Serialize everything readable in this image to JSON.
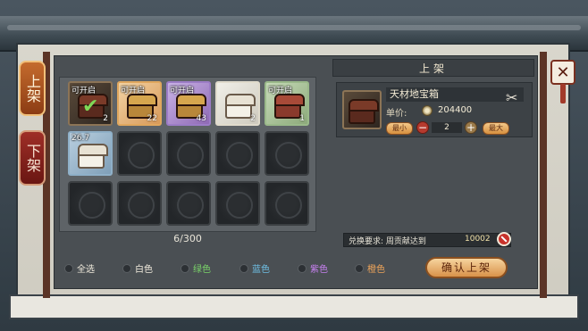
{
  "side_tabs": [
    {
      "label": "上架",
      "active": true
    },
    {
      "label": "下架",
      "active": false
    }
  ],
  "close_icon": "close-x-icon",
  "inventory": {
    "count": "6/300",
    "slots": [
      {
        "state": "item",
        "quality": "dark",
        "tag": "可开启",
        "count": "2",
        "selected": true,
        "icon": "chest-icon"
      },
      {
        "state": "item",
        "quality": "orange",
        "tag": "可开启",
        "count": "22",
        "selected": false,
        "icon": "chest-icon"
      },
      {
        "state": "item",
        "quality": "purple",
        "tag": "可开启",
        "count": "43",
        "selected": false,
        "icon": "chest-icon"
      },
      {
        "state": "item",
        "quality": "white",
        "tag": "",
        "count": "2",
        "selected": false,
        "icon": "chest-icon"
      },
      {
        "state": "item",
        "quality": "green",
        "tag": "可开启",
        "count": "1",
        "selected": false,
        "icon": "chest-icon"
      },
      {
        "state": "item",
        "quality": "blue",
        "tag": "26.7",
        "count": "",
        "selected": false,
        "icon": "chest-icon"
      },
      {
        "state": "empty"
      },
      {
        "state": "empty"
      },
      {
        "state": "empty"
      },
      {
        "state": "empty"
      },
      {
        "state": "empty"
      },
      {
        "state": "empty"
      },
      {
        "state": "empty"
      },
      {
        "state": "empty"
      },
      {
        "state": "empty"
      }
    ]
  },
  "detail": {
    "header": "上架",
    "item_name": "天材地宝箱",
    "price_label": "单价:",
    "price_value": "204400",
    "qty_min_label": "最小",
    "qty_max_label": "最大",
    "qty_value": "2",
    "requirement_label": "兑换要求: 周贡献达到",
    "requirement_value": "10002"
  },
  "filters": [
    {
      "label": "全选",
      "class": "f-all"
    },
    {
      "label": "白色",
      "class": "f-white"
    },
    {
      "label": "绿色",
      "class": "f-green"
    },
    {
      "label": "蓝色",
      "class": "f-blue"
    },
    {
      "label": "紫色",
      "class": "f-purple"
    },
    {
      "label": "橙色",
      "class": "f-orange"
    }
  ],
  "confirm_label": "确认上架",
  "colors": {
    "accent_orange": "#d9924a",
    "panel_dark": "#4a4f53",
    "green": "#7bd66a",
    "blue": "#6fc0e6",
    "purple": "#c780f0",
    "orange": "#f0a55a"
  }
}
